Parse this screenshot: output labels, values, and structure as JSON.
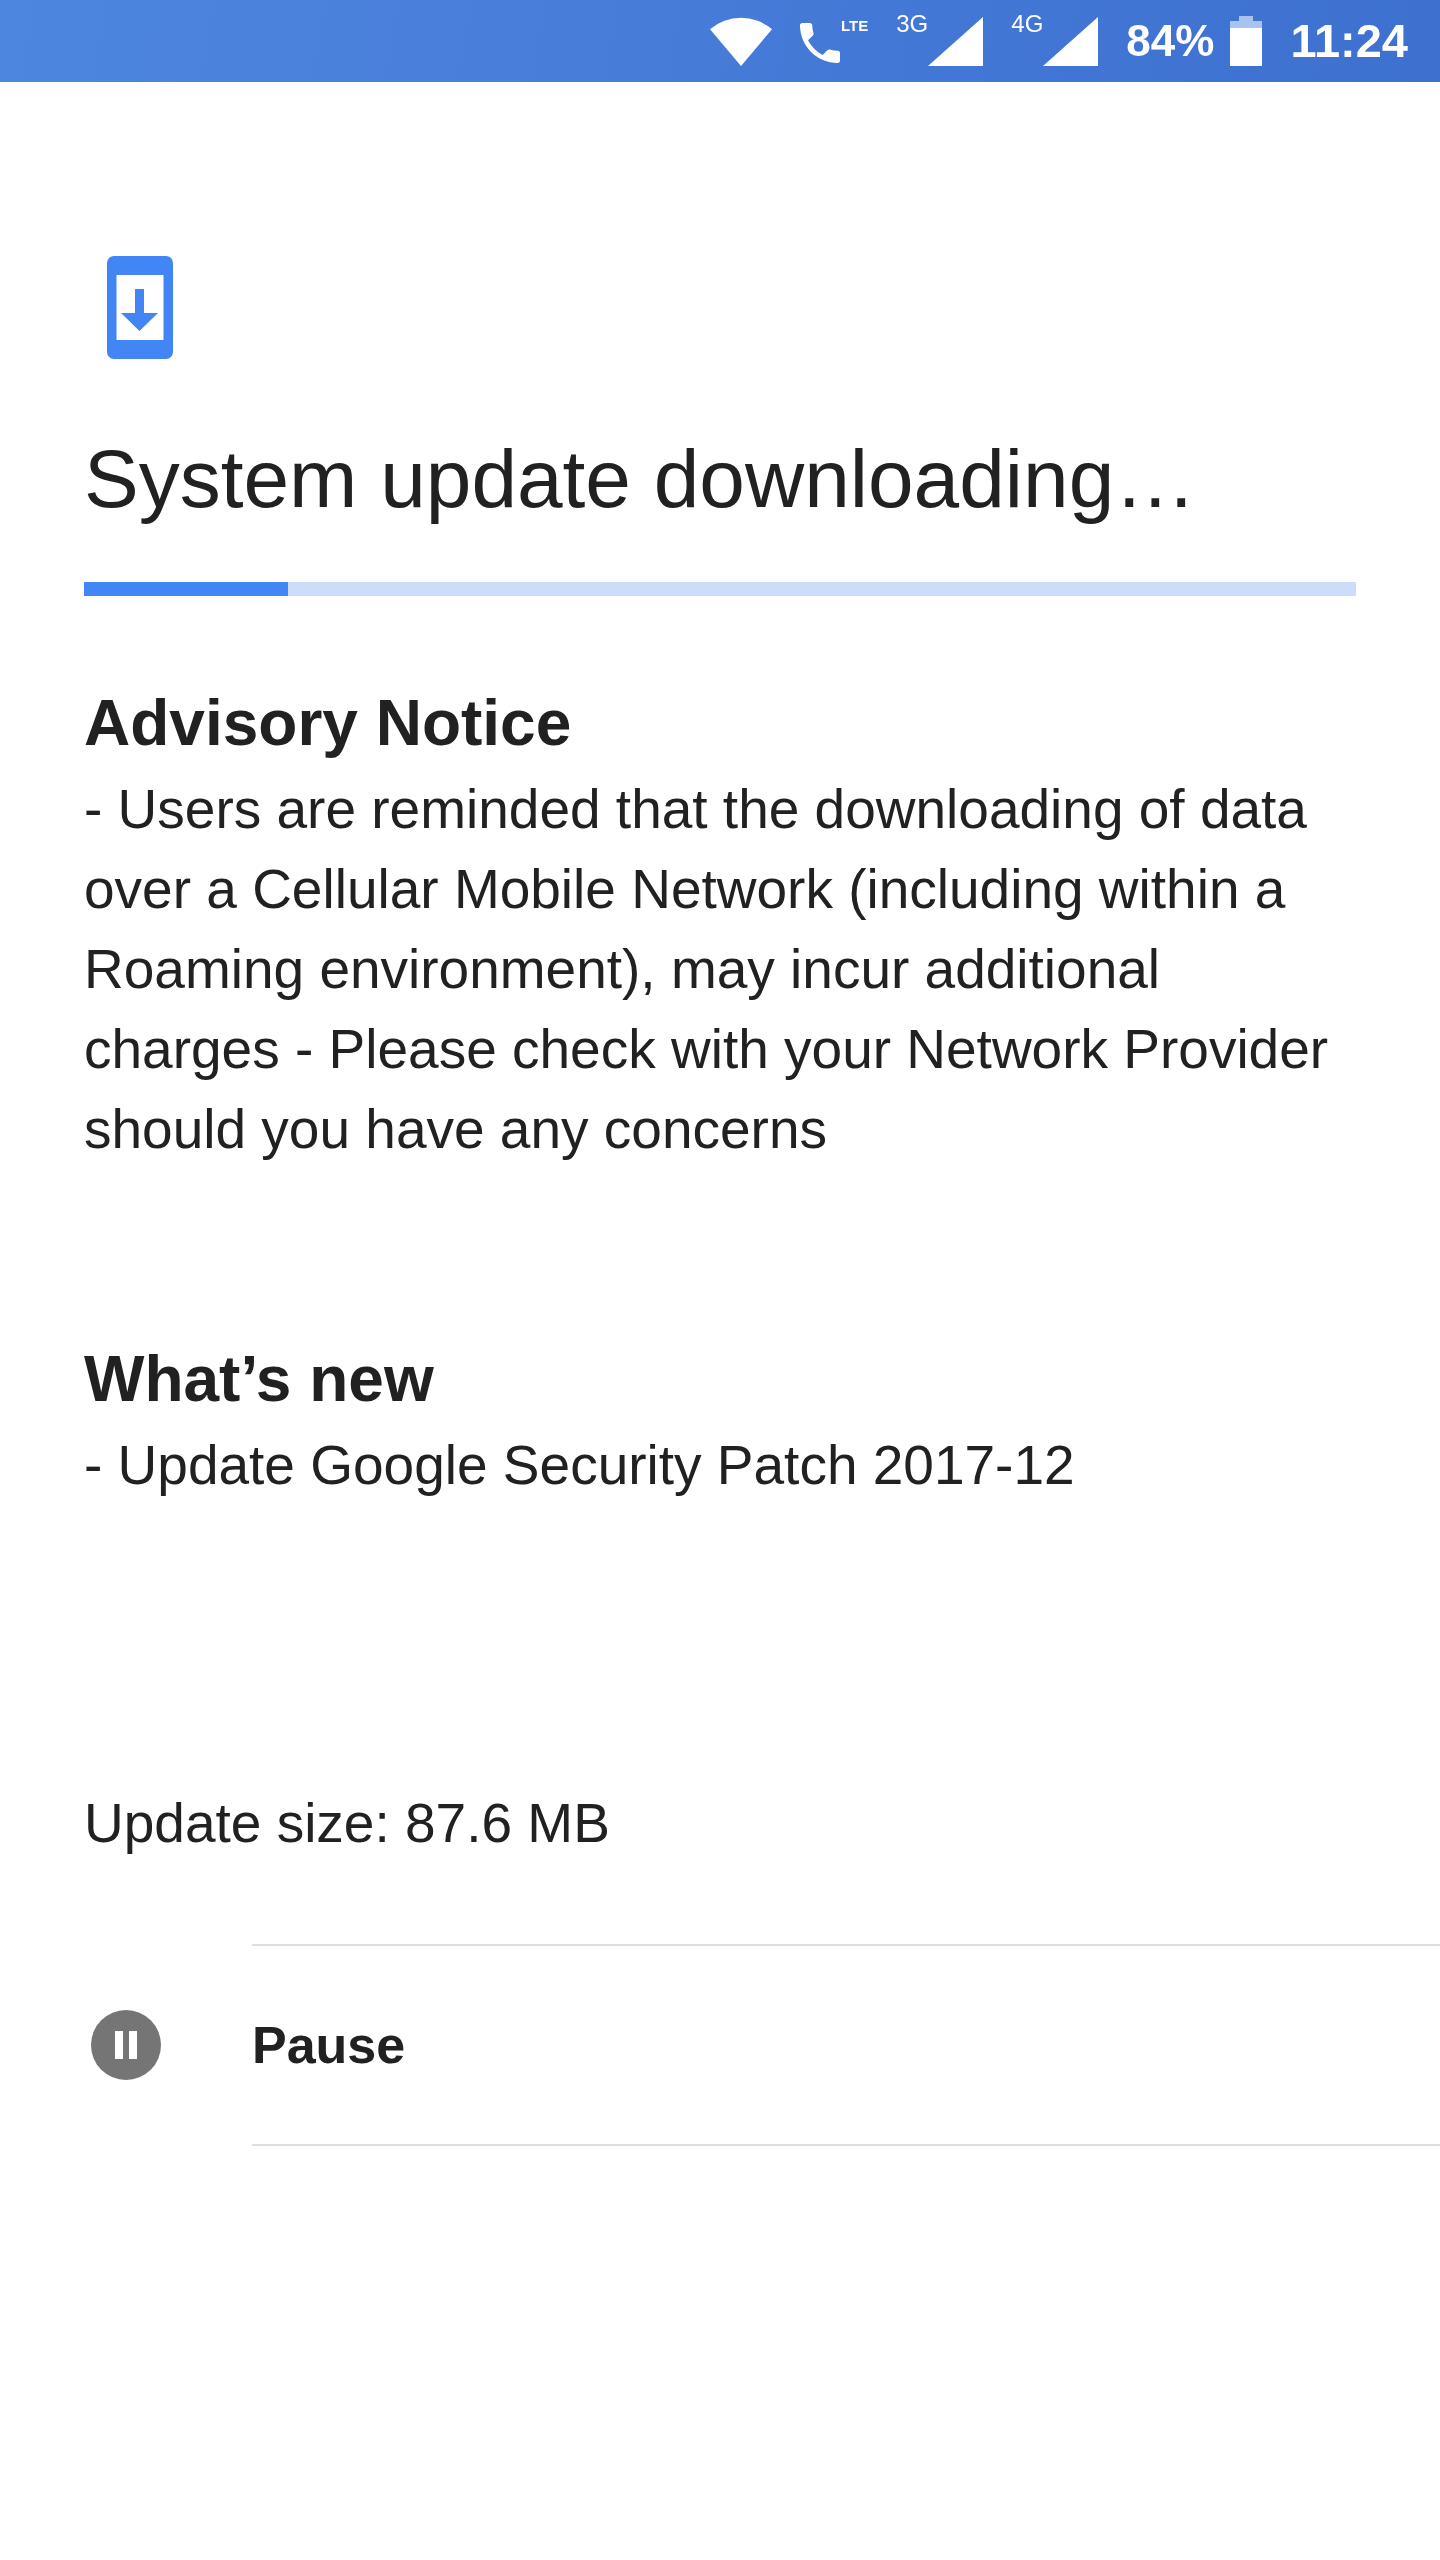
{
  "status_bar": {
    "call_badge": "LTE",
    "signals": [
      {
        "label": "3G"
      },
      {
        "label": "4G"
      }
    ],
    "battery_text": "84%",
    "time": "11:24"
  },
  "update": {
    "title": "System update downloading…",
    "progress": {
      "level": 0.16
    },
    "sections": [
      {
        "heading": "Advisory Notice",
        "body": "- Users are reminded that the downloading of data over a Cellular Mobile Network (including within a Roaming environment), may incur additional charges - Please check with your Network Provider should you have any concerns"
      },
      {
        "heading": "What’s new",
        "body": "- Update Google Security Patch 2017-12"
      }
    ],
    "size": "Update size: 87.6 MB",
    "actions": [
      {
        "kind": "pause",
        "label": "Pause"
      }
    ]
  }
}
